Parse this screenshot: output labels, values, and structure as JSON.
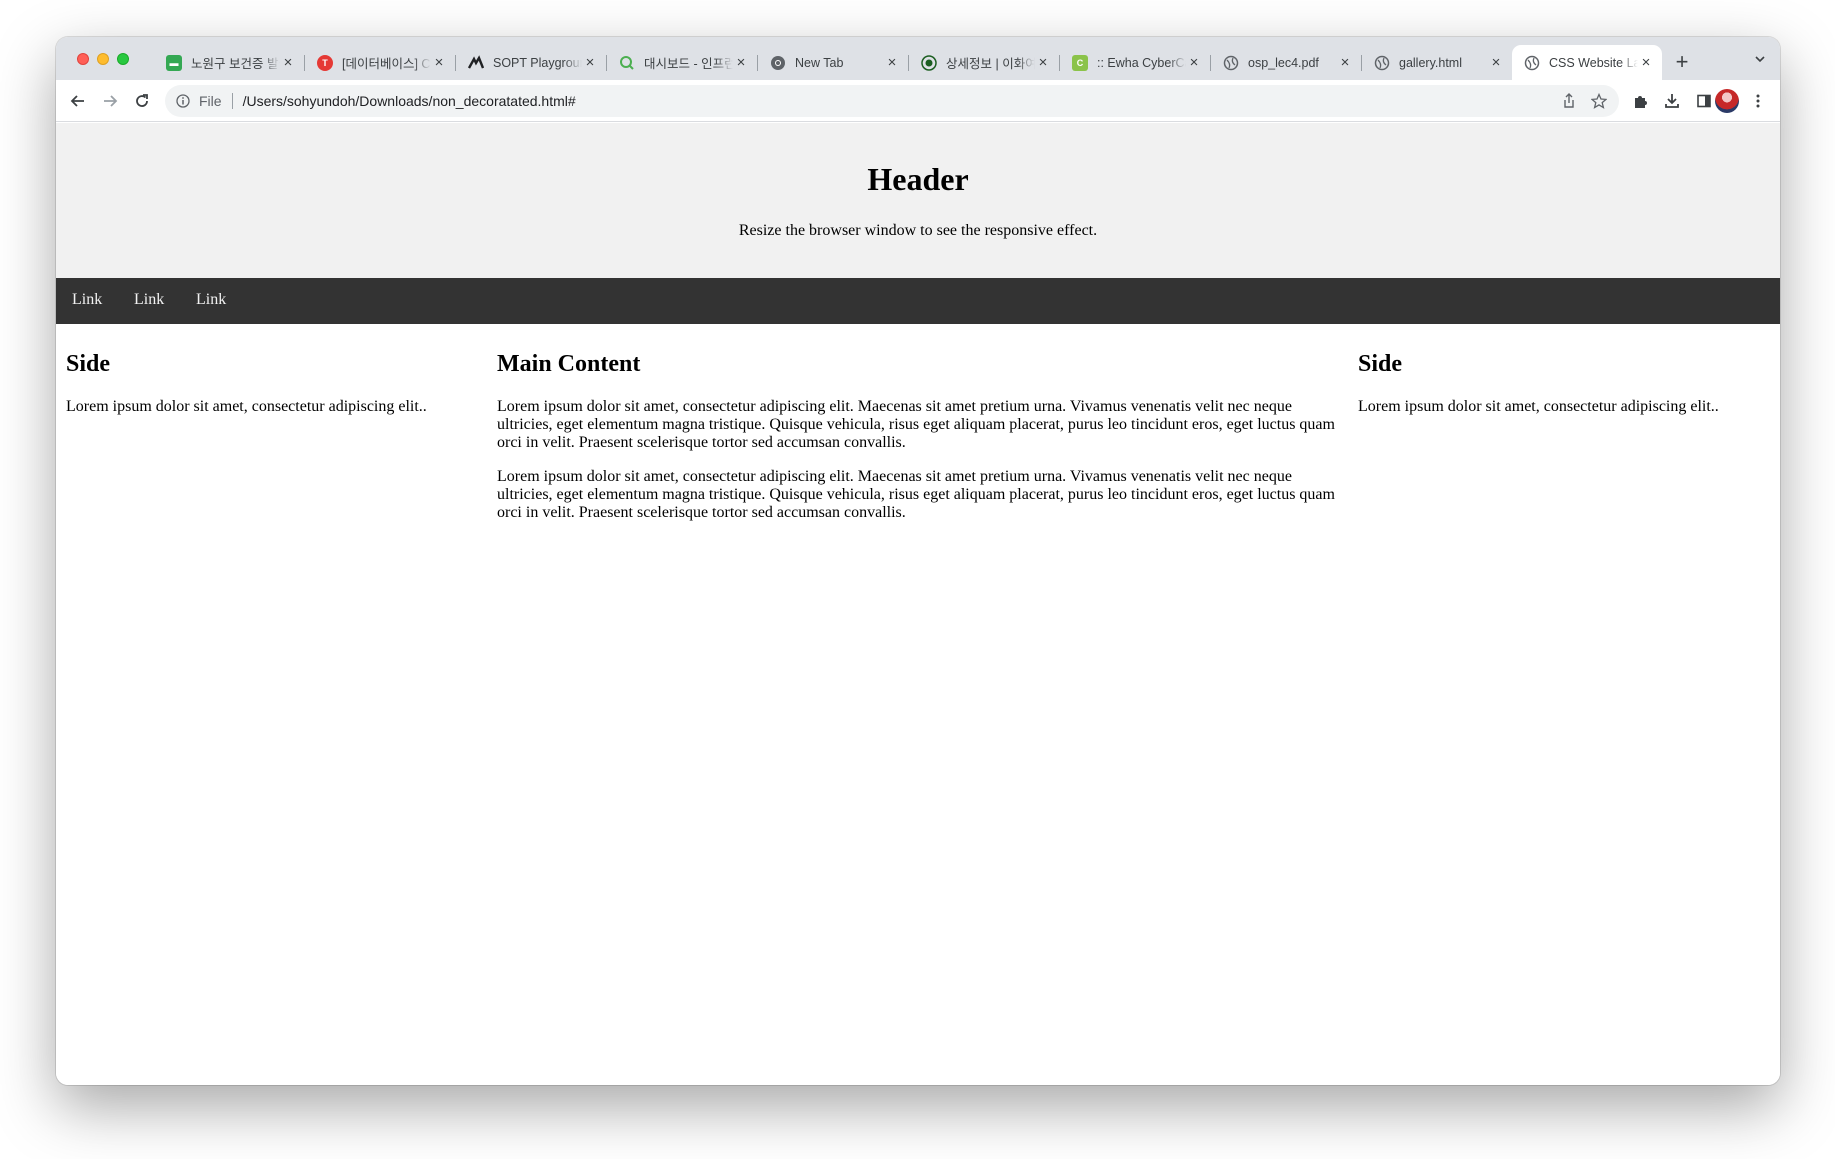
{
  "browser": {
    "tabs": [
      {
        "title": "노원구 보건증 발급",
        "favicon": "green-chat-icon",
        "favicon_color": "#34a853"
      },
      {
        "title": "[데이터베이스] CH",
        "favicon": "red-t-icon",
        "favicon_color": "#e53935"
      },
      {
        "title": "SOPT Playground",
        "favicon": "sopt-logo-icon",
        "favicon_color": "#202124"
      },
      {
        "title": "대시보드 - 인프런",
        "favicon": "search-leaf-icon",
        "favicon_color": "#4caf50"
      },
      {
        "title": "New Tab",
        "favicon": "chrome-icon",
        "favicon_color": "#5f6368"
      },
      {
        "title": "상세정보 | 이화여대",
        "favicon": "university-seal-icon",
        "favicon_color": "#1b5e20"
      },
      {
        "title": ":: Ewha CyberCampus",
        "favicon": "c-logo-icon",
        "favicon_color": "#8bc34a"
      },
      {
        "title": "osp_lec4.pdf",
        "favicon": "globe-icon",
        "favicon_color": "#5f6368"
      },
      {
        "title": "gallery.html",
        "favicon": "globe-icon",
        "favicon_color": "#5f6368"
      },
      {
        "title": "CSS Website Layout",
        "favicon": "globe-icon",
        "favicon_color": "#5f6368",
        "active": true
      }
    ],
    "new_tab_label": "+",
    "address": {
      "scheme_label": "File",
      "url": "/Users/sohyundoh/Downloads/non_decoratated.html#"
    }
  },
  "page": {
    "header": {
      "title": "Header",
      "subtitle": "Resize the browser window to see the responsive effect."
    },
    "nav": {
      "links": [
        "Link",
        "Link",
        "Link"
      ],
      "background": "#333333",
      "link_color": "#f2f2f2"
    },
    "left": {
      "heading": "Side",
      "text": "Lorem ipsum dolor sit amet, consectetur adipiscing elit.."
    },
    "main": {
      "heading": "Main Content",
      "paragraphs": [
        "Lorem ipsum dolor sit amet, consectetur adipiscing elit. Maecenas sit amet pretium urna. Vivamus venenatis velit nec neque ultricies, eget elementum magna tristique. Quisque vehicula, risus eget aliquam placerat, purus leo tincidunt eros, eget luctus quam orci in velit. Praesent scelerisque tortor sed accumsan convallis.",
        "Lorem ipsum dolor sit amet, consectetur adipiscing elit. Maecenas sit amet pretium urna. Vivamus venenatis velit nec neque ultricies, eget elementum magna tristique. Quisque vehicula, risus eget aliquam placerat, purus leo tincidunt eros, eget luctus quam orci in velit. Praesent scelerisque tortor sed accumsan convallis."
      ]
    },
    "right": {
      "heading": "Side",
      "text": "Lorem ipsum dolor sit amet, consectetur adipiscing elit.."
    }
  }
}
